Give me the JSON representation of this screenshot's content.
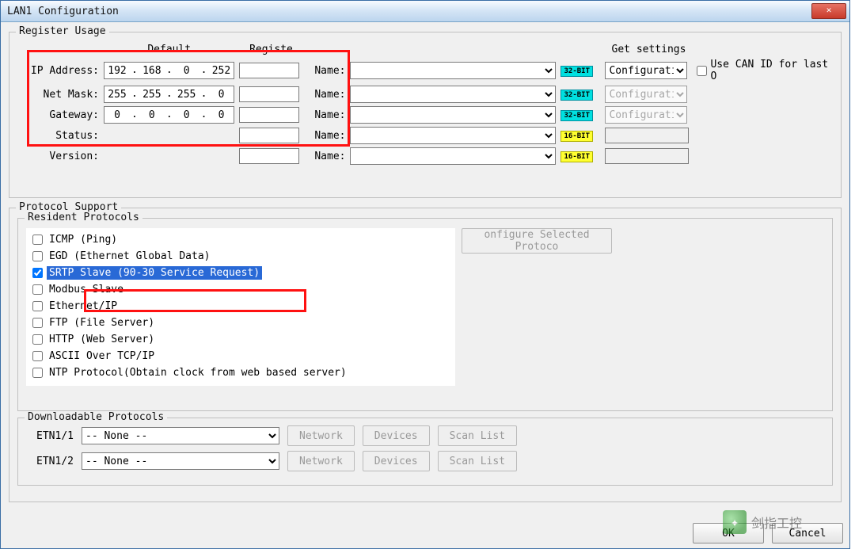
{
  "window": {
    "title": "LAN1 Configuration"
  },
  "group_register": {
    "legend": "Register Usage",
    "col_default": "Default",
    "col_registe": "Registe",
    "col_get_settings": "Get settings",
    "use_can_label": "Use CAN ID for last O",
    "name_label": "Name:",
    "rows": {
      "ip": {
        "label": "IP Address:",
        "octets": [
          "192",
          "168",
          "0",
          "252"
        ],
        "bits": "32-BIT",
        "config": "Configuratio",
        "config_enabled": true
      },
      "mask": {
        "label": "Net Mask:",
        "octets": [
          "255",
          "255",
          "255",
          "0"
        ],
        "bits": "32-BIT",
        "config": "Configuratio",
        "config_enabled": false
      },
      "gateway": {
        "label": "Gateway:",
        "octets": [
          "0",
          "0",
          "0",
          "0"
        ],
        "bits": "32-BIT",
        "config": "Configuratio",
        "config_enabled": false
      },
      "status": {
        "label": "Status:",
        "bits": "16-BIT"
      },
      "version": {
        "label": "Version:",
        "bits": "16-BIT"
      }
    }
  },
  "group_protocol": {
    "legend": "Protocol Support",
    "resident_legend": "Resident Protocols",
    "configure_btn": "onfigure Selected Protoco",
    "items": [
      {
        "label": "ICMP (Ping)",
        "checked": false
      },
      {
        "label": "EGD (Ethernet Global Data)",
        "checked": false
      },
      {
        "label": "SRTP Slave (90-30 Service Request)",
        "checked": true,
        "selected": true
      },
      {
        "label": "Modbus Slave",
        "checked": false
      },
      {
        "label": "Ethernet/IP",
        "checked": false
      },
      {
        "label": "FTP (File Server)",
        "checked": false
      },
      {
        "label": "HTTP (Web Server)",
        "checked": false
      },
      {
        "label": "ASCII Over TCP/IP",
        "checked": false
      },
      {
        "label": "NTP Protocol(Obtain clock from web based server)",
        "checked": false
      }
    ],
    "downloadable_legend": "Downloadable Protocols",
    "dl": [
      {
        "label": "ETN1/1",
        "value": "-- None --"
      },
      {
        "label": "ETN1/2",
        "value": "-- None --"
      }
    ],
    "btn_network": "Network",
    "btn_devices": "Devices",
    "btn_scanlist": "Scan List"
  },
  "footer": {
    "ok": "OK",
    "cancel": "Cancel"
  },
  "watermark": "剑指工控"
}
